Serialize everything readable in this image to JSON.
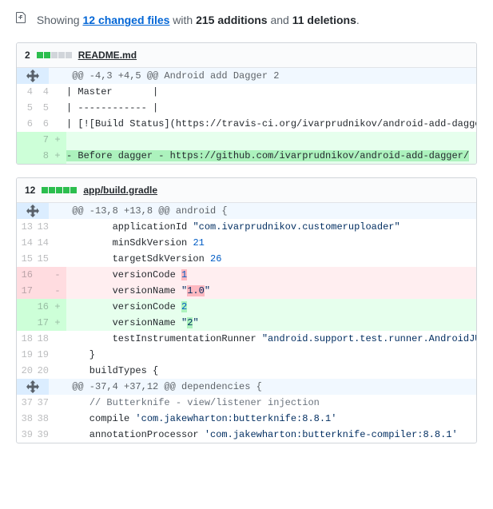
{
  "summary": {
    "prefix": "Showing ",
    "changed_files_text": "12 changed files",
    "mid": " with ",
    "additions": "215 additions",
    "and": " and ",
    "deletions": "11 deletions",
    "end": "."
  },
  "files": [
    {
      "stat_count": "2",
      "diffstat": [
        "add",
        "add",
        "neu",
        "neu",
        "neu"
      ],
      "name": "README.md",
      "hunks": [
        {
          "header": "@@ -4,3 +4,5 @@ Android add Dagger 2",
          "lines": [
            {
              "type": "ctx",
              "lOld": "4",
              "lNew": "4",
              "code": "| Master       |"
            },
            {
              "type": "ctx",
              "lOld": "5",
              "lNew": "5",
              "code": "| ------------ |"
            },
            {
              "type": "ctx",
              "lOld": "6",
              "lNew": "6",
              "code": "| [![Build Status](https://travis-ci.org/ivarprudnikov/android-add-dagger.svg)](https://travis-ci.org/ivarprudnikov/android-add-dagger) |"
            },
            {
              "type": "add",
              "lOld": "",
              "lNew": "7",
              "code": ""
            },
            {
              "type": "add",
              "lOld": "",
              "lNew": "8",
              "hl": "- Before dagger - https://github.com/ivarprudnikov/android-add-dagger/",
              "code": ""
            }
          ]
        }
      ]
    },
    {
      "stat_count": "12",
      "diffstat": [
        "add",
        "add",
        "add",
        "add",
        "add"
      ],
      "name": "app/build.gradle",
      "hunks": [
        {
          "header": "@@ -13,8 +13,8 @@ android {",
          "lines": [
            {
              "type": "ctx",
              "lOld": "13",
              "lNew": "13",
              "html": "        applicationId <span class='tk-str'>\"com.ivarprudnikov.customeruploader\"</span>"
            },
            {
              "type": "ctx",
              "lOld": "14",
              "lNew": "14",
              "html": "        minSdkVersion <span class='tk-num'>21</span>"
            },
            {
              "type": "ctx",
              "lOld": "15",
              "lNew": "15",
              "html": "        targetSdkVersion <span class='tk-num'>26</span>"
            },
            {
              "type": "del",
              "lOld": "16",
              "lNew": "",
              "html": "        versionCode <span class='hl-del'><span class='tk-num'>1</span></span>"
            },
            {
              "type": "del",
              "lOld": "17",
              "lNew": "",
              "html": "        versionName <span class='tk-str'>\"<span class='hl-del'>1.0</span>\"</span>"
            },
            {
              "type": "add",
              "lOld": "",
              "lNew": "16",
              "html": "        versionCode <span class='hl-add'><span class='tk-num'>2</span></span>"
            },
            {
              "type": "add",
              "lOld": "",
              "lNew": "17",
              "html": "        versionName <span class='tk-str'>\"<span class='hl-add'>2</span>\"</span>"
            },
            {
              "type": "ctx",
              "lOld": "18",
              "lNew": "18",
              "html": "        testInstrumentationRunner <span class='tk-str'>\"android.support.test.runner.AndroidJUnitRunner\"</span>"
            },
            {
              "type": "ctx",
              "lOld": "19",
              "lNew": "19",
              "code": "    }"
            },
            {
              "type": "ctx",
              "lOld": "20",
              "lNew": "20",
              "code": "    buildTypes {"
            }
          ]
        },
        {
          "header": "@@ -37,4 +37,12 @@ dependencies {",
          "lines": [
            {
              "type": "ctx",
              "lOld": "37",
              "lNew": "37",
              "html": "    <span class='tk-cmt'>// Butterknife - view/listener injection</span>"
            },
            {
              "type": "ctx",
              "lOld": "38",
              "lNew": "38",
              "html": "    compile <span class='tk-str'>'com.jakewharton:butterknife:8.8.1'</span>"
            },
            {
              "type": "ctx",
              "lOld": "39",
              "lNew": "39",
              "html": "    annotationProcessor <span class='tk-str'>'com.jakewharton:butterknife-compiler:8.8.1'</span>"
            }
          ]
        }
      ]
    }
  ]
}
